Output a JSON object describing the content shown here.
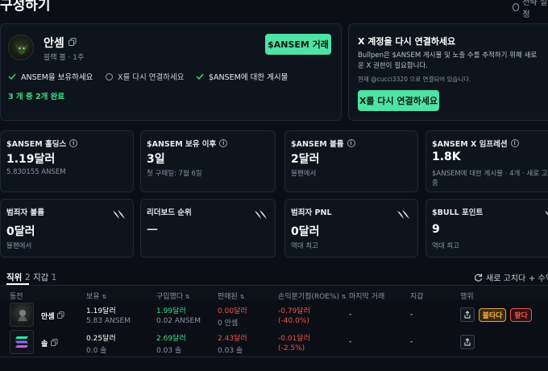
{
  "page": {
    "title_partial": "구성하기",
    "settings_label": "전략 설정"
  },
  "profile": {
    "name": "안셈",
    "subtitle": "블랙 볼 · 1주",
    "trade_button": "$ANSEM 거래",
    "checklist": [
      {
        "label": "ANSEM을 보유하세요",
        "done": true
      },
      {
        "label": "X를 다시 연결하세요",
        "done": false
      },
      {
        "label": "$ANSEM에 대한 게시물",
        "done": true
      }
    ],
    "progress_text": "3 개 중 2개 완료",
    "completed_steps": 2,
    "total_steps": 3
  },
  "x_panel": {
    "title": "X 계정을 다시 연결하세요",
    "description_line1": "Bullpen은 $ANSEM 게시물 및 노출 수를 추적하기 위해 새로",
    "description_line2": "운 X 권한이 필요합니다.",
    "connected_note": "현재 @cucci3320 으로 연결되어 있습니다.",
    "button": "X를 다시 연결하세요"
  },
  "stats_row1": [
    {
      "label": "$ANSEM 홀딩스",
      "value": "1.19달러",
      "sub": "5.830155 ANSEM"
    },
    {
      "label": "$ANSEM 보유 이후",
      "value": "3일",
      "sub": "첫 구매일: 7월 6일"
    },
    {
      "label": "$ANSEM 볼륨",
      "value": "2달러",
      "sub": "불펜에서"
    },
    {
      "label": "$ANSEM X 임프레션",
      "value": "1.8K",
      "sub": "$ANSEM에 대한 게시물 · 4개 · 새로 고침 대",
      "sub2": "중"
    }
  ],
  "stats_row2": [
    {
      "label": "범죄자 볼륨",
      "value": "0달러",
      "sub": "불펜에서"
    },
    {
      "label": "리더보드 순위",
      "value": "—",
      "sub": ""
    },
    {
      "label": "범죄자 PNL",
      "value": "0달러",
      "sub": "역대 최고"
    },
    {
      "label": "$BULL 포인트",
      "value": "9",
      "sub": "역대 최고"
    }
  ],
  "tabs": [
    {
      "label": "직위",
      "count": "2",
      "active": true
    },
    {
      "label": "지갑",
      "count": "1",
      "active": false
    }
  ],
  "actions": {
    "refresh": "새로 고치다",
    "add": "+ 수익"
  },
  "table": {
    "headers": [
      "동전",
      "보유",
      "구입했다",
      "판매된",
      "손익분기점(ROE%)",
      "마지막 거래",
      "지갑",
      "행위"
    ],
    "rows": [
      {
        "coin": "안셈",
        "hold_value": "1.19달러",
        "hold_amount": "5.83 ANSEM",
        "bought_value": "1.99달러",
        "bought_amount": "0.02 ANSEM",
        "sold_value": "0.00달러",
        "sold_amount": "0 안셈",
        "pnl_value": "-0.79달러",
        "pnl_pct": "(-40.0%)",
        "last_trade": "-",
        "wallet": "-",
        "buy_label": "불타다",
        "sell_label": "팔다"
      },
      {
        "coin": "솔",
        "hold_value": "0.25달러",
        "hold_amount": "0.0 솔",
        "bought_value": "2.69달러",
        "bought_amount": "0.03 솔",
        "sold_value": "2.43달러",
        "sold_amount": "0.03 솔",
        "pnl_value": "-0.01달러",
        "pnl_pct": "(-2.5%)",
        "last_trade": "-",
        "wallet": "-"
      }
    ]
  },
  "colors": {
    "accent": "#4ee3a4",
    "positive": "#3ddc84",
    "negative": "#ef5350",
    "bg": "#0b0f15"
  }
}
